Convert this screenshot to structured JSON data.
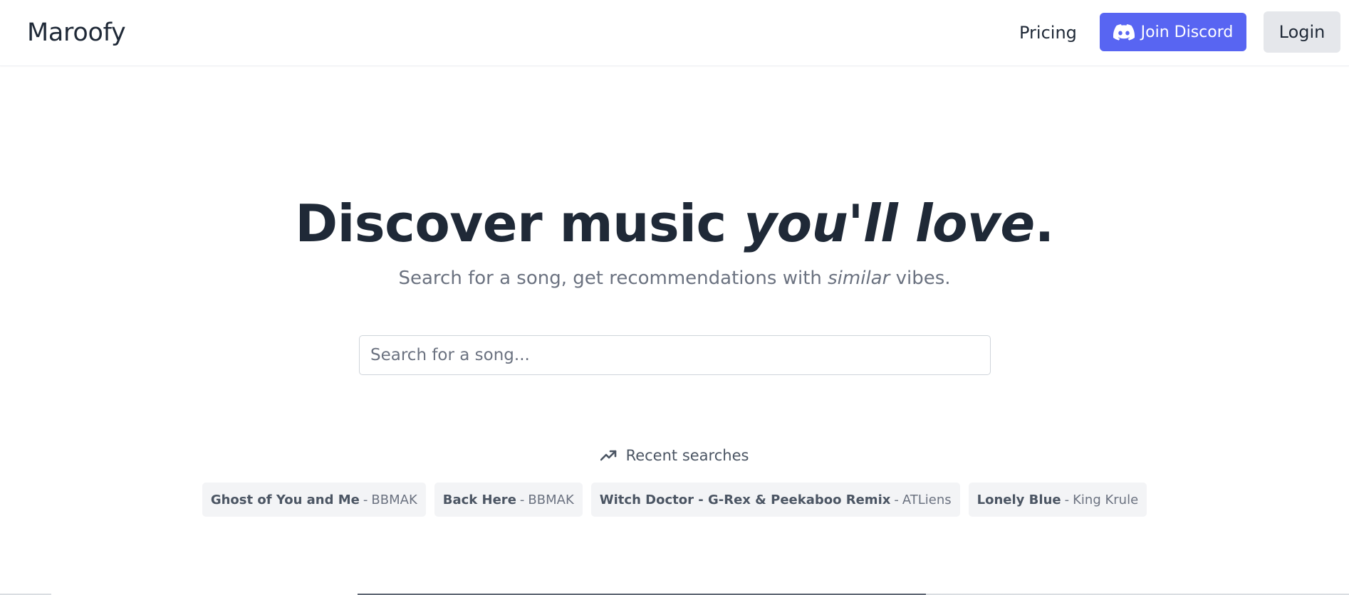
{
  "header": {
    "logo": "Maroofy",
    "pricing_label": "Pricing",
    "discord_label": "Join Discord",
    "discord_icon": "discord-icon",
    "login_label": "Login"
  },
  "hero": {
    "title_plain": "Discover music ",
    "title_em": "you'll love",
    "title_end": ".",
    "subtitle_a": "Search for a song, get recommendations with ",
    "subtitle_em": "similar",
    "subtitle_b": " vibes."
  },
  "search": {
    "placeholder": "Search for a song...",
    "value": ""
  },
  "recent": {
    "icon": "trending-up-icon",
    "heading": "Recent searches",
    "items": [
      {
        "song": "Ghost of You and Me",
        "sep": "-",
        "artist": "BBMAK"
      },
      {
        "song": "Back Here",
        "sep": "-",
        "artist": "BBMAK"
      },
      {
        "song": "Witch Doctor - G-Rex & Peekaboo Remix",
        "sep": "-",
        "artist": "ATLiens"
      },
      {
        "song": "Lonely Blue",
        "sep": "-",
        "artist": "King Krule"
      }
    ]
  },
  "colors": {
    "discord": "#5865f2",
    "text": "#1f2937",
    "muted": "#6b7280",
    "chip_bg": "#f3f4f6"
  }
}
